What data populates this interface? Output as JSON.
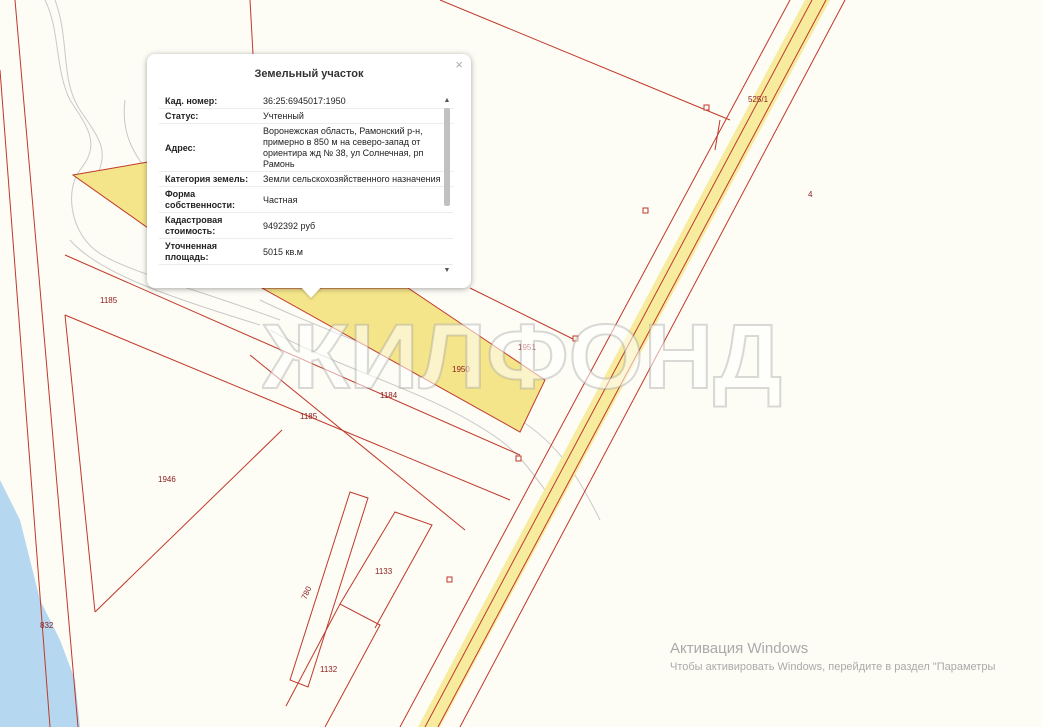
{
  "popup": {
    "title": "Земельный участок",
    "close_icon": "×",
    "rows": [
      {
        "key": "Кад. номер:",
        "value": "36:25:6945017:1950"
      },
      {
        "key": "Статус:",
        "value": "Учтенный"
      },
      {
        "key": "Адрес:",
        "value": "Воронежская область, Рамонский р-н, примерно в 850 м на северо-запад от ориентира жд № 38, ул Солнечная, рп Рамонь"
      },
      {
        "key": "Категория земель:",
        "value": "Земли сельскохозяйственного назначения"
      },
      {
        "key": "Форма собственности:",
        "value": "Частная"
      },
      {
        "key": "Кадастровая стоимость:",
        "value": "9492392 руб"
      },
      {
        "key": "Уточненная площадь:",
        "value": "5015 кв.м"
      }
    ]
  },
  "map": {
    "plot_labels": [
      "1185",
      "1185",
      "1184",
      "1950",
      "1951",
      "1946",
      "1133",
      "780",
      "1132",
      "832",
      "525/1",
      "4"
    ],
    "colors": {
      "background": "#fdfcf5",
      "boundary": "#c0392b",
      "road_fill": "#f7ec9e",
      "selected_parcel": "#f5e58a",
      "water": "#b5d7f0"
    }
  },
  "watermark": {
    "text": "ЖИЛФОНД"
  },
  "windows_activation": {
    "title": "Активация Windows",
    "subtitle": "Чтобы активировать Windows, перейдите в раздел \"Параметры"
  }
}
